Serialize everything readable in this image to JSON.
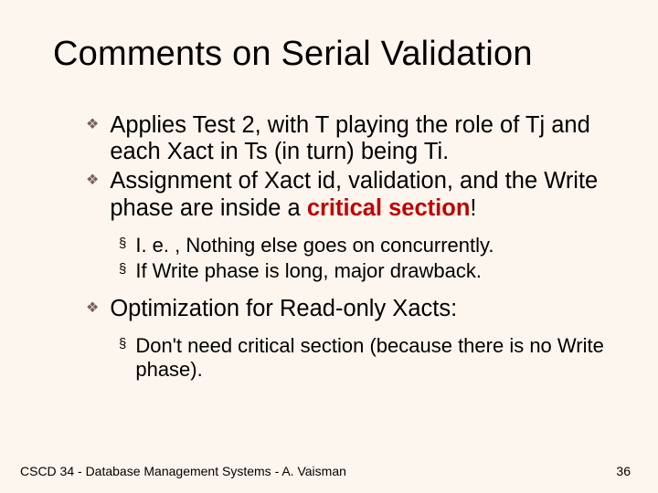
{
  "title": "Comments on Serial Validation",
  "bullets": [
    {
      "text": "Applies Test 2, with T playing the role of Tj and each Xact in Ts (in turn) being Ti."
    },
    {
      "text_prefix": "Assignment of Xact id, validation, and the Write phase are inside a ",
      "critical": "critical section",
      "suffix": "!",
      "sub": [
        "I. e. , Nothing else goes on concurrently.",
        "If Write phase is long, major drawback."
      ]
    },
    {
      "text": "Optimization for Read-only Xacts:",
      "sub": [
        "Don't need critical section (because there is no Write phase)."
      ]
    }
  ],
  "footer": "CSCD 34 - Database Management Systems - A. Vaisman",
  "page_number": "36"
}
